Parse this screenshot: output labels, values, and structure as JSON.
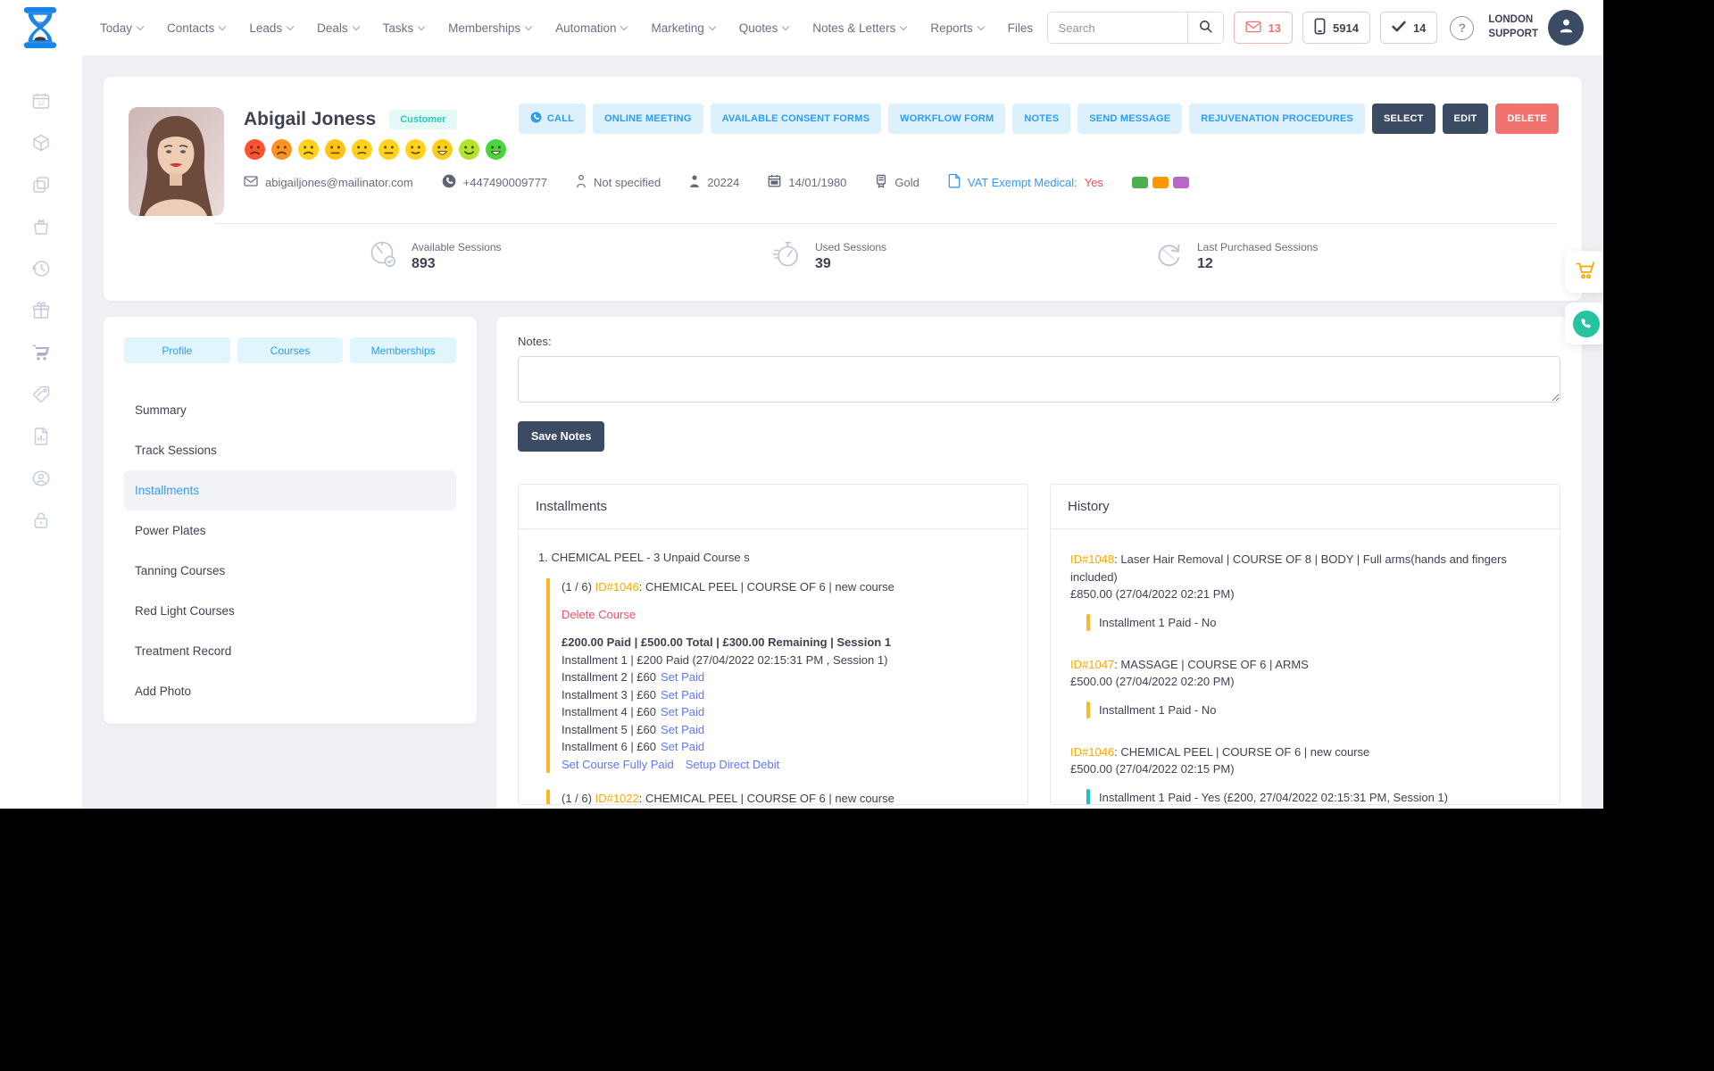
{
  "topnav": {
    "items": [
      "Today",
      "Contacts",
      "Leads",
      "Deals",
      "Tasks",
      "Memberships",
      "Automation",
      "Marketing",
      "Quotes",
      "Notes & Letters",
      "Reports",
      "Files"
    ],
    "search_placeholder": "Search",
    "mail_count": "13",
    "sms_count": "5914",
    "task_count": "14",
    "help_label": "?",
    "location_line1": "LONDON",
    "location_line2": "SUPPORT"
  },
  "profile": {
    "name": "Abigail Joness",
    "type_badge": "Customer",
    "emojis": [
      {
        "color": "#ff5230",
        "mouth": "sad"
      },
      {
        "color": "#ff9322",
        "mouth": "sad"
      },
      {
        "color": "#ffd21c",
        "mouth": "sad"
      },
      {
        "color": "#ffc414",
        "mouth": "neutral"
      },
      {
        "color": "#ffd21c",
        "mouth": "slight_sad"
      },
      {
        "color": "#ffd21c",
        "mouth": "neutral"
      },
      {
        "color": "#ffd21c",
        "mouth": "slight_smile"
      },
      {
        "color": "#ffce18",
        "mouth": "grin"
      },
      {
        "color": "#b0e52c",
        "mouth": "smile"
      },
      {
        "color": "#49d53d",
        "mouth": "grin"
      }
    ],
    "email": "abigailjones@mailinator.com",
    "phone": "+447490009777",
    "gender": "Not specified",
    "customer_id": "20224",
    "dob": "14/01/1980",
    "tier": "Gold",
    "vat_label": "VAT Exempt Medical:",
    "vat_value": "Yes",
    "tags": [
      "#4caf50",
      "#ff9800",
      "#ba68c8"
    ],
    "actions": {
      "call": "CALL",
      "online_meeting": "ONLINE MEETING",
      "consent_forms": "AVAILABLE CONSENT FORMS",
      "workflow_form": "WORKFLOW FORM",
      "notes": "NOTES",
      "send_message": "SEND MESSAGE",
      "rejuvenation": "REJUVENATION PROCEDURES",
      "select": "SELECT",
      "edit": "EDIT",
      "delete": "DELETE"
    },
    "stats": [
      {
        "label": "Available Sessions",
        "value": "893"
      },
      {
        "label": "Used Sessions",
        "value": "39"
      },
      {
        "label": "Last Purchased Sessions",
        "value": "12"
      }
    ]
  },
  "side_panel": {
    "tabs": [
      "Profile",
      "Courses",
      "Memberships"
    ],
    "menu": [
      "Summary",
      "Track Sessions",
      "Installments",
      "Power Plates",
      "Tanning Courses",
      "Red Light Courses",
      "Treatment Record",
      "Add Photo"
    ],
    "active_item": "Installments"
  },
  "notes": {
    "label": "Notes:",
    "value": "",
    "save_label": "Save Notes"
  },
  "installments": {
    "title": "Installments",
    "group_heading": "1. CHEMICAL PEEL - 3 Unpaid Course s",
    "course1": {
      "progress": "(1 / 6)",
      "id": "ID#1046",
      "title": ": CHEMICAL PEEL | COURSE OF 6 | new course",
      "delete_link": "Delete Course",
      "summary": "£200.00 Paid | £500.00 Total | £300.00 Remaining | Session 1",
      "paid_line": "Installment 1 | £200 Paid (27/04/2022 02:15:31 PM , Session 1)",
      "unpaid": [
        {
          "label": "Installment 2 | £60",
          "action": "Set Paid"
        },
        {
          "label": "Installment 3 | £60",
          "action": "Set Paid"
        },
        {
          "label": "Installment 4 | £60",
          "action": "Set Paid"
        },
        {
          "label": "Installment 5 | £60",
          "action": "Set Paid"
        },
        {
          "label": "Installment 6 | £60",
          "action": "Set Paid"
        }
      ],
      "fully_paid_link": "Set Course Fully Paid",
      "direct_debit_link": "Setup Direct Debit",
      "bar_color": "#ffb822"
    },
    "course2": {
      "progress": "(1 / 6)",
      "id": "ID#1022",
      "title": ": CHEMICAL PEEL | COURSE OF 6 | new course",
      "bar_color": "#ffb822"
    }
  },
  "history": {
    "title": "History",
    "entries": [
      {
        "id": "ID#1048",
        "title": ": Laser Hair Removal | COURSE OF 8 | BODY | Full arms(hands and fingers included)",
        "amount": "£850.00 (27/04/2022 02:21 PM)",
        "status": "Installment 1 Paid - No",
        "bar_color": "#ffb822"
      },
      {
        "id": "ID#1047",
        "title": ": MASSAGE | COURSE OF 6 | ARMS",
        "amount": "£500.00 (27/04/2022 02:20 PM)",
        "status": "Installment 1 Paid - No",
        "bar_color": "#ffb822"
      },
      {
        "id": "ID#1046",
        "title": ": CHEMICAL PEEL | COURSE OF 6 | new course",
        "amount": "£500.00 (27/04/2022 02:15 PM)",
        "status": "Installment 1 Paid - Yes (£200, 27/04/2022 02:15:31 PM, Session 1)",
        "bar_color": "#1bc5bd"
      }
    ]
  }
}
